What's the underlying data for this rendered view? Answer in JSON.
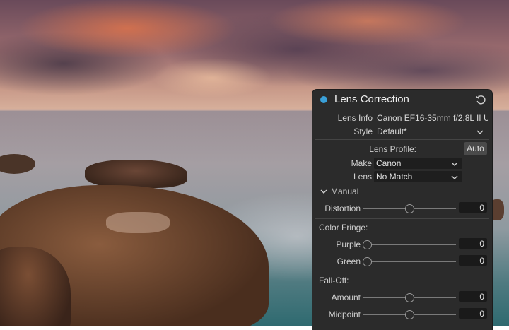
{
  "panel": {
    "title": "Lens Correction",
    "accent_color": "#3aa0d8",
    "lens_info_label": "Lens Info",
    "lens_info_value": "Canon EF16-35mm f/2.8L II U...",
    "style_label": "Style",
    "style_value": "Default*",
    "lens_profile_label": "Lens Profile:",
    "auto_label": "Auto",
    "make_label": "Make",
    "make_value": "Canon",
    "lens_label": "Lens",
    "lens_value": "No Match",
    "manual_label": "Manual",
    "distortion_label": "Distortion",
    "distortion_value": "0",
    "color_fringe_label": "Color Fringe:",
    "purple_label": "Purple",
    "purple_value": "0",
    "green_label": "Green",
    "green_value": "0",
    "falloff_label": "Fall-Off:",
    "amount_label": "Amount",
    "amount_value": "0",
    "midpoint_label": "Midpoint",
    "midpoint_value": "0"
  },
  "icons": {
    "reset": "reset-icon",
    "chevron": "chevron-down-icon"
  }
}
